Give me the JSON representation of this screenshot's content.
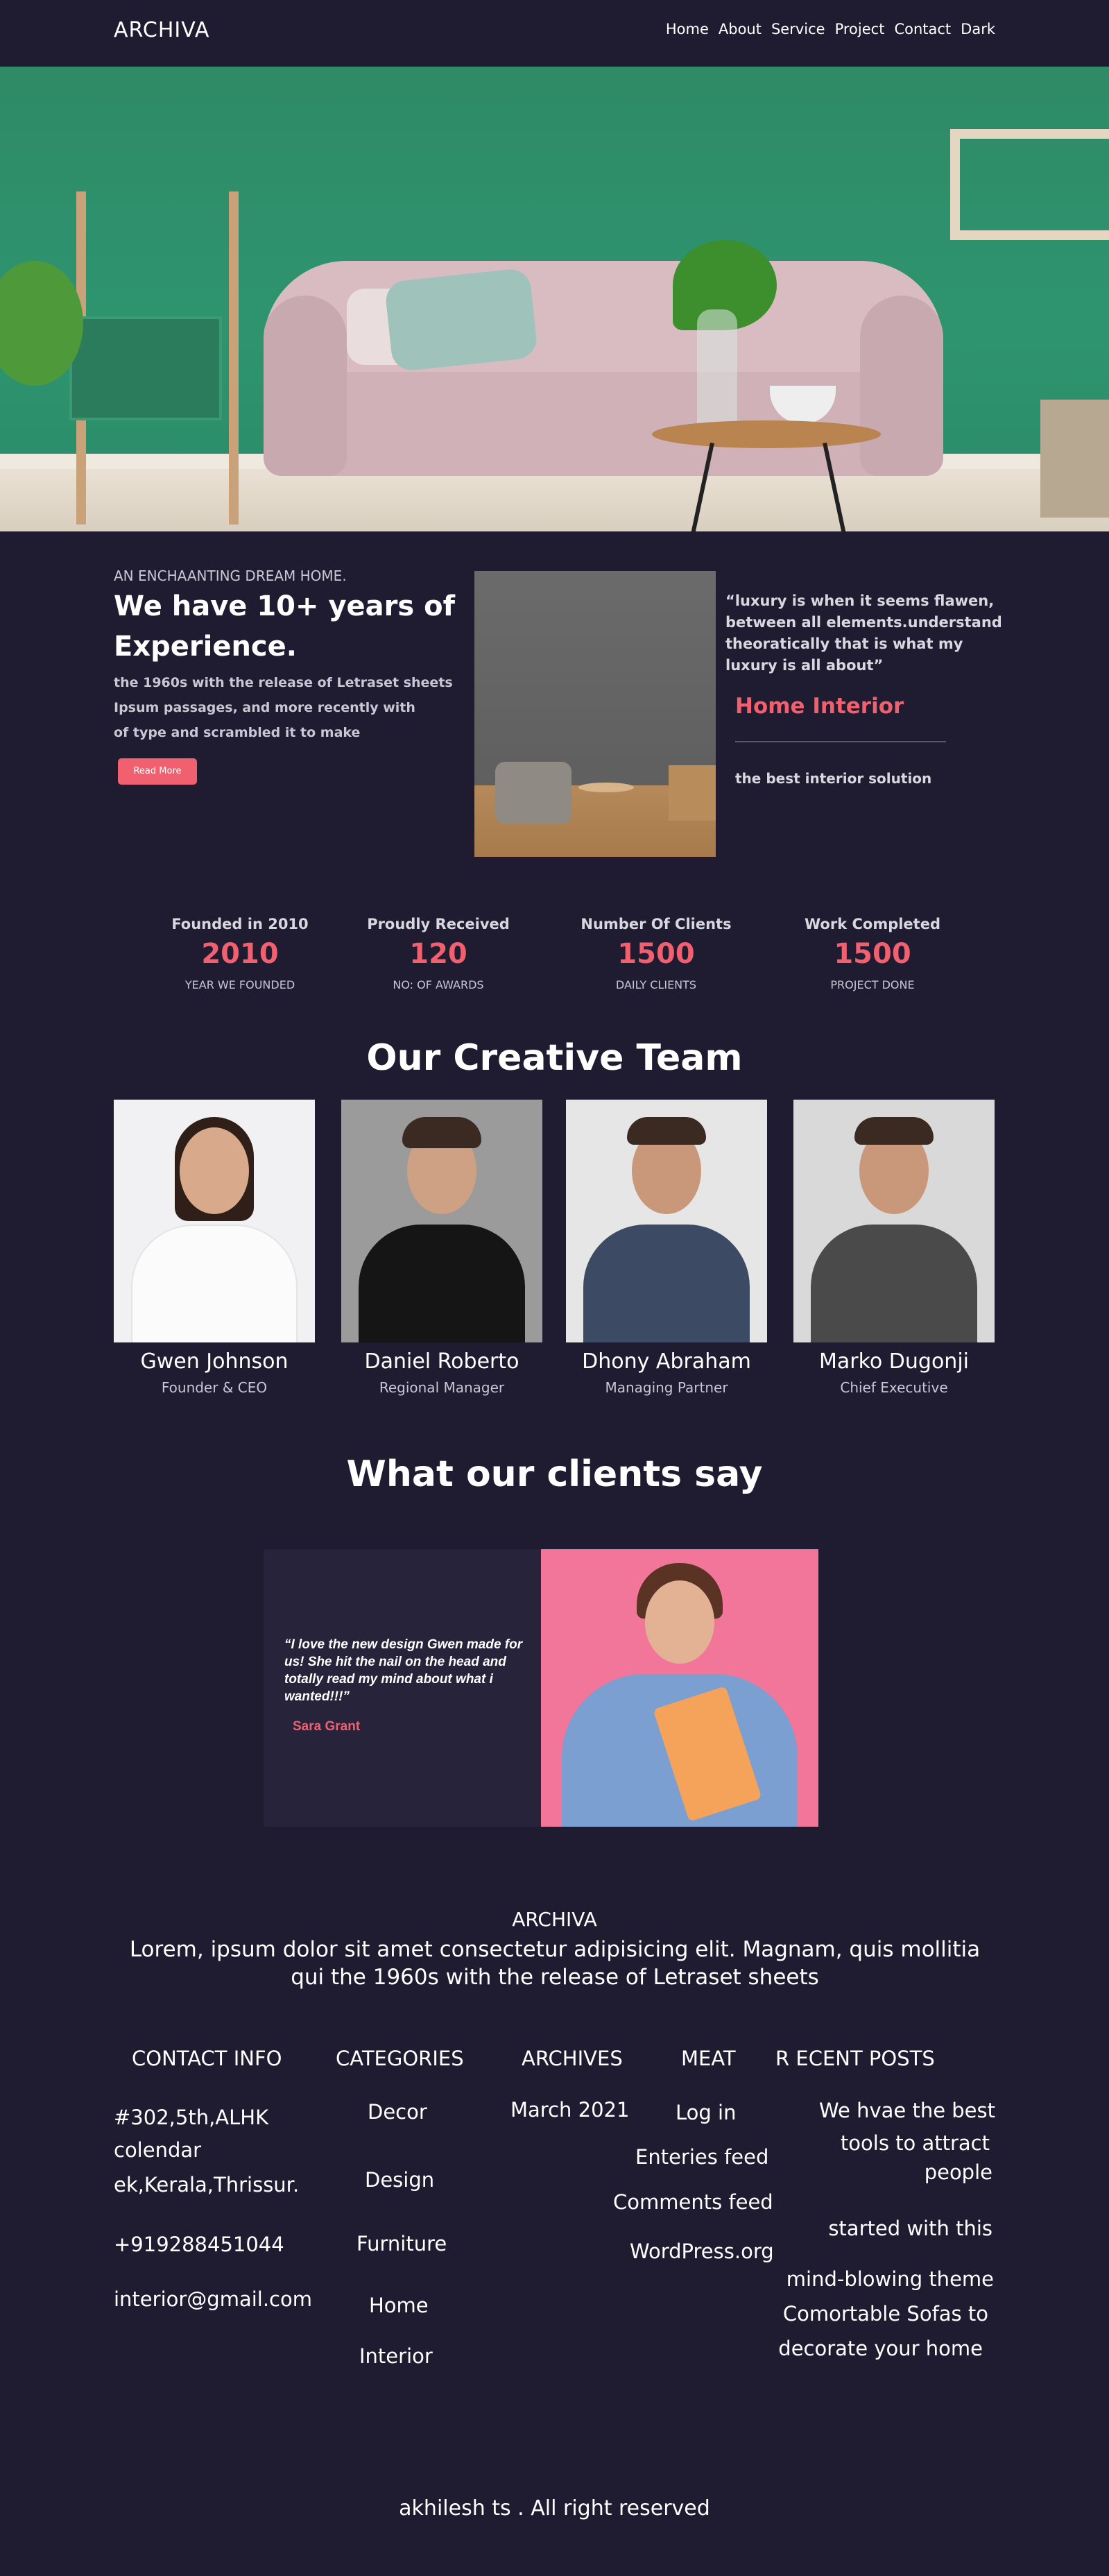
{
  "nav": {
    "brand": "ARCHIVA",
    "items": [
      "Home",
      "About",
      "Service",
      "Project",
      "Contact",
      "Dark"
    ]
  },
  "about": {
    "kicker": "AN ENCHAANTING DREAM HOME.",
    "title": "We have 10+ years of Experience.",
    "text_lines": [
      "the 1960s with the release of Letraset sheets",
      "Ipsum passages, and more recently with",
      "of type and scrambled it to make"
    ],
    "button": "Read More",
    "quote": "“luxury is when it seems flawen, between all elements.understand theoratically that is what my luxury is all about”",
    "quote_title": "Home Interior",
    "quote_sub": "the best interior solution"
  },
  "stats": [
    {
      "title": "Founded in 2010",
      "value": "2010",
      "sub": "YEAR WE FOUNDED"
    },
    {
      "title": "Proudly Received",
      "value": "120",
      "sub": "NO: OF  AWARDS"
    },
    {
      "title": "Number Of  Clients",
      "value": "1500",
      "sub": "DAILY CLIENTS"
    },
    {
      "title": "Work Completed",
      "value": "1500",
      "sub": "PROJECT DONE"
    }
  ],
  "team": {
    "title": "Our Creative Team",
    "members": [
      {
        "name": "Gwen Johnson",
        "role": "Founder & CEO"
      },
      {
        "name": "Daniel Roberto",
        "role": "Regional Manager"
      },
      {
        "name": "Dhony Abraham",
        "role": "Managing Partner"
      },
      {
        "name": "Marko Dugonji",
        "role": "Chief Executive"
      }
    ]
  },
  "testimonials": {
    "title": "What our clients say",
    "quote": "“I love the new design Gwen made for us! She hit the nail on the head and totally read my mind about what i wanted!!!”",
    "author": "Sara Grant"
  },
  "footer": {
    "brand": "ARCHIVA",
    "lorem": "Lorem, ipsum dolor sit amet consectetur adipisicing elit. Magnam, quis mollitia qui the 1960s with the release of Letraset sheets",
    "contact": {
      "heading": "CONTACT INFO",
      "address1": "#302,5th,ALHK",
      "address2": "colendar",
      "address3": "ek,Kerala,Thrissur.",
      "phone": "+919288451044",
      "email": "interior@gmail.com"
    },
    "categories": {
      "heading": "CATEGORIES",
      "items": [
        "Decor",
        "Design",
        "Furniture",
        "Home",
        "Interior"
      ]
    },
    "archives": {
      "heading": "ARCHIVES",
      "items": [
        "March 2021"
      ]
    },
    "meta": {
      "heading": "MEAT",
      "items": [
        "Log in",
        "Enteries feed",
        "Comments feed",
        "WordPress.org"
      ]
    },
    "recent": {
      "heading": "R ECENT POSTS",
      "lines": [
        "We hvae the best",
        "tools to attract",
        "people",
        "started with this",
        "mind-blowing theme",
        "Comortable Sofas to",
        "decorate your home"
      ]
    },
    "copyright": "akhilesh ts . All right reserved"
  }
}
